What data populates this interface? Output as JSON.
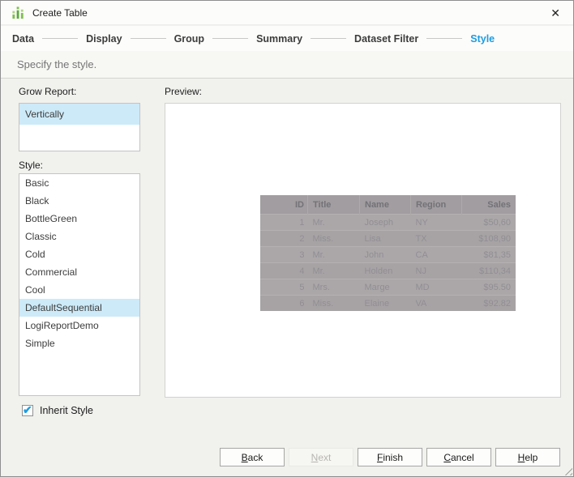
{
  "window": {
    "title": "Create Table",
    "close_glyph": "✕"
  },
  "wizard": {
    "steps": [
      "Data",
      "Display",
      "Group",
      "Summary",
      "Dataset Filter",
      "Style"
    ],
    "active_step": "Style"
  },
  "subtitle": "Specify the style.",
  "grow_report": {
    "label": "Grow Report:",
    "options": [
      "Vertically"
    ],
    "selected": "Vertically"
  },
  "style_picker": {
    "label": "Style:",
    "options": [
      "Basic",
      "Black",
      "BottleGreen",
      "Classic",
      "Cold",
      "Commercial",
      "Cool",
      "DefaultSequential",
      "LogiReportDemo",
      "Simple"
    ],
    "selected": "DefaultSequential"
  },
  "inherit_style": {
    "label": "Inherit Style",
    "checked": true,
    "check_glyph": "✔"
  },
  "preview": {
    "label": "Preview:",
    "table": {
      "columns": [
        "ID",
        "Title",
        "Name",
        "Region",
        "Sales"
      ],
      "rows": [
        [
          "1",
          "Mr.",
          "Joseph",
          "NY",
          "$50,60"
        ],
        [
          "2",
          "Miss.",
          "Lisa",
          "TX",
          "$108,90"
        ],
        [
          "3",
          "Mr.",
          "John",
          "CA",
          "$81,35"
        ],
        [
          "4",
          "Mr.",
          "Holden",
          "NJ",
          "$110,34"
        ],
        [
          "5",
          "Mrs.",
          "Marge",
          "MD",
          "$95.50"
        ],
        [
          "6",
          "Miss.",
          "Elaine",
          "VA",
          "$92.82"
        ]
      ]
    }
  },
  "buttons": [
    {
      "label": "Back",
      "mnemonic": "B",
      "enabled": true
    },
    {
      "label": "Next",
      "mnemonic": "N",
      "enabled": false
    },
    {
      "label": "Finish",
      "mnemonic": "F",
      "enabled": true
    },
    {
      "label": "Cancel",
      "mnemonic": "C",
      "enabled": true
    },
    {
      "label": "Help",
      "mnemonic": "H",
      "enabled": true
    }
  ],
  "colors": {
    "accent_blue": "#1e9ce2",
    "selection_blue": "#cdeaf8",
    "icon_green_dark": "#5ba83b",
    "icon_green": "#7fbf4d",
    "icon_green_light": "#aad47e"
  }
}
